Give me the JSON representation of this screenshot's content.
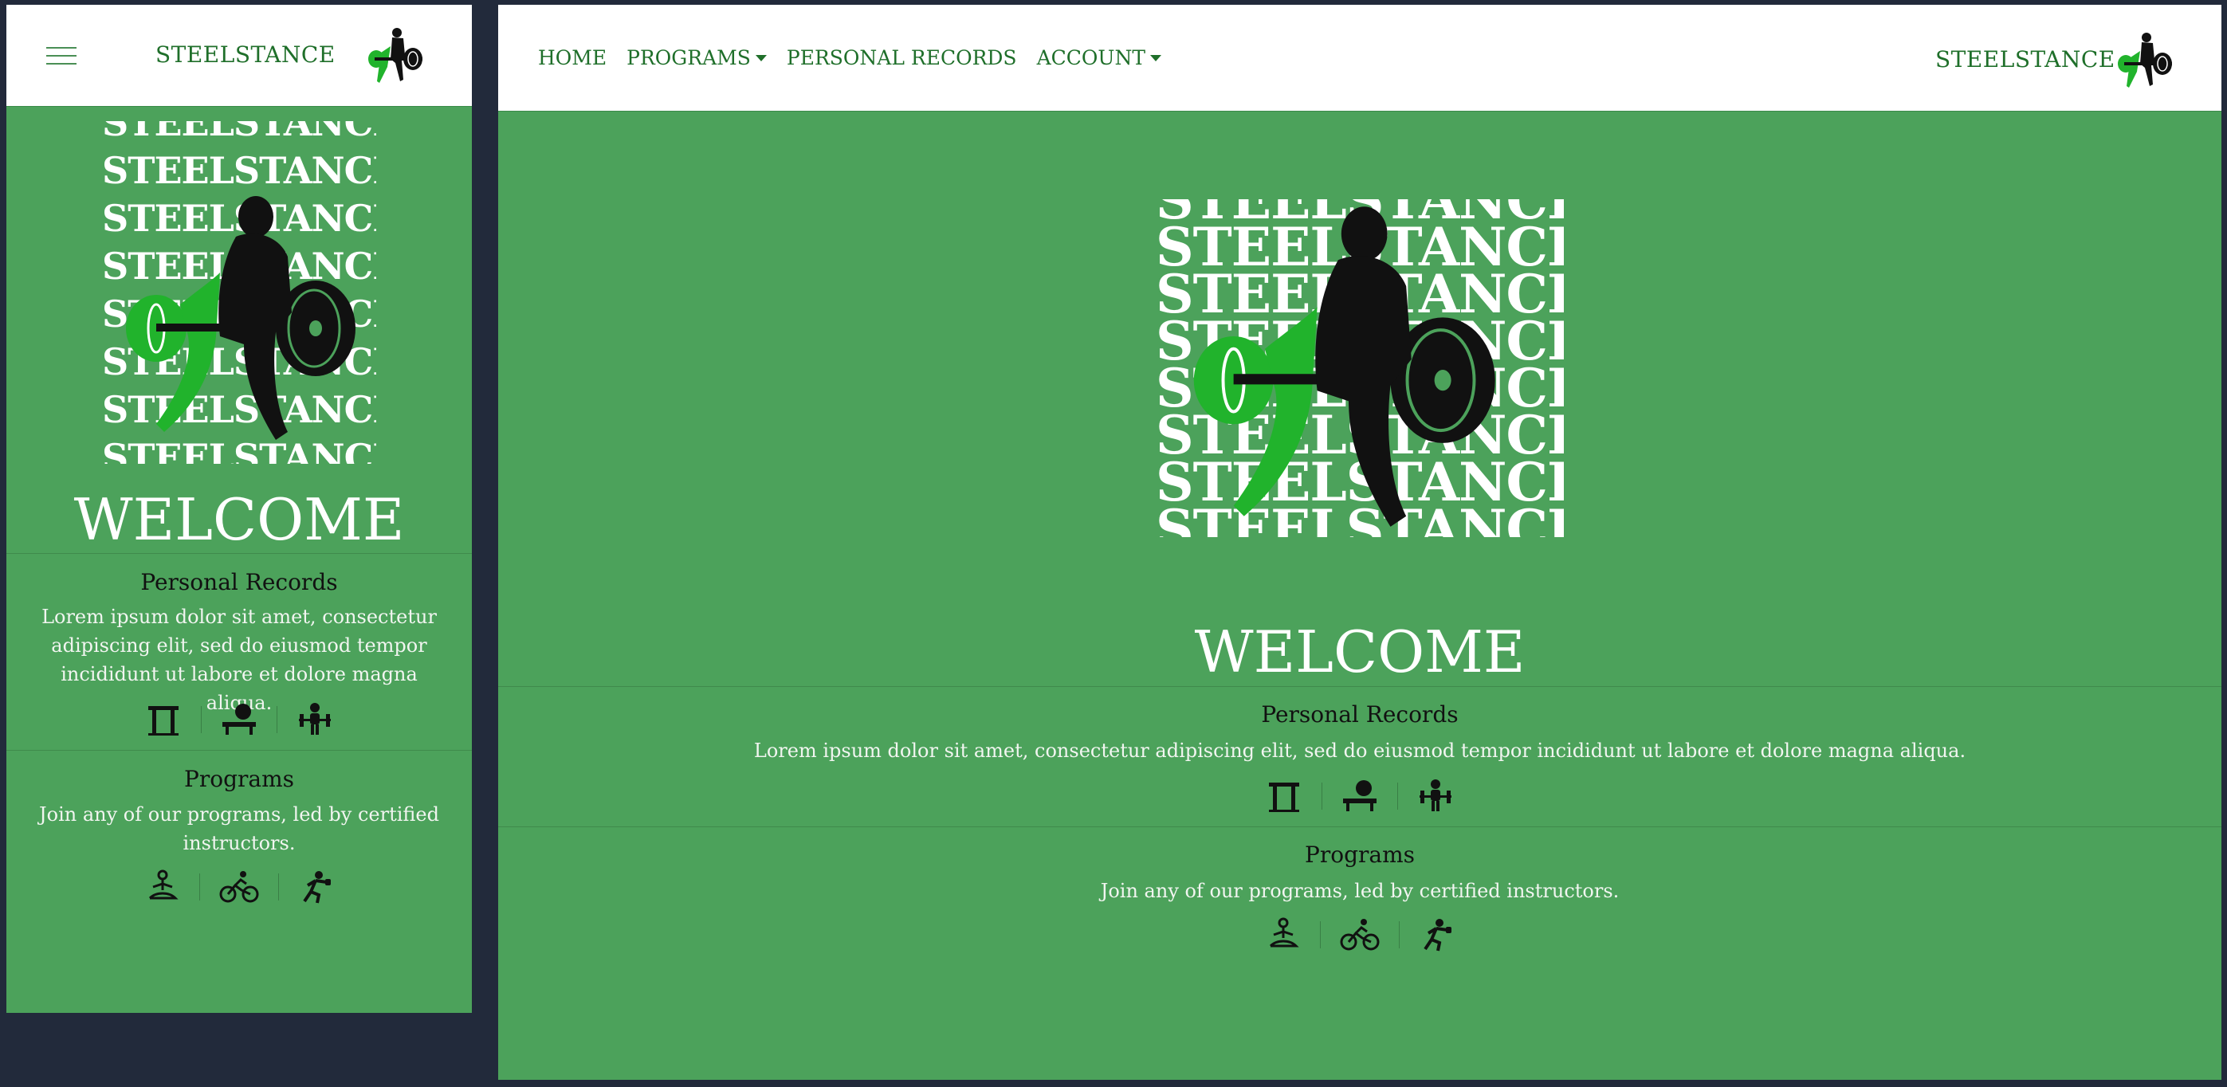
{
  "brand": "STEELSTANCE",
  "hero_word": "STEELSTANCE",
  "nav": {
    "home": "HOME",
    "programs": "PROGRAMS",
    "personal_records": "PERSONAL RECORDS",
    "account": "ACCOUNT"
  },
  "welcome": "WELCOME",
  "sections": {
    "records": {
      "title": "Personal Records",
      "text": "Lorem ipsum dolor sit amet, consectetur adipiscing elit, sed do eiusmod tempor incididunt ut labore et dolore magna aliqua.",
      "icons": [
        "squat-rack-icon",
        "bench-press-icon",
        "deadlift-icon"
      ]
    },
    "programs": {
      "title": "Programs",
      "text": "Join any of our programs, led by certified instructors.",
      "icons": [
        "yoga-icon",
        "cycling-icon",
        "boxing-icon"
      ]
    }
  },
  "colors": {
    "background": "#4ca25b",
    "nav_text": "#1f6f2a",
    "page": "#222a3b",
    "accent_green": "#22b12e"
  }
}
